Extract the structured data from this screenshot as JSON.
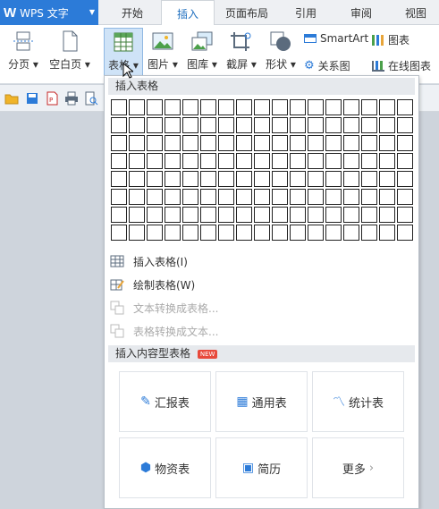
{
  "app": {
    "name": "WPS 文字"
  },
  "tabs": [
    {
      "label": "开始"
    },
    {
      "label": "插入"
    },
    {
      "label": "页面布局"
    },
    {
      "label": "引用"
    },
    {
      "label": "审阅"
    },
    {
      "label": "视图"
    }
  ],
  "ribbon": {
    "page_break": "分页",
    "blank_page": "空白页",
    "table": "表格",
    "picture": "图片",
    "gallery": "图库",
    "screenshot": "截屏",
    "shape": "形状",
    "smartart": "SmartArt",
    "chart": "图表",
    "relation": "关系图",
    "online_chart": "在线图表"
  },
  "dropdown": {
    "insert_table_header": "插入表格",
    "grid": {
      "columns": 17,
      "rows": 8
    },
    "menu": {
      "insert_table": "插入表格(I)",
      "draw_table": "绘制表格(W)",
      "text_to_table": "文本转换成表格...",
      "table_to_text": "表格转换成文本..."
    },
    "content_header": "插入内容型表格",
    "new_badge": "NEW",
    "cards": {
      "report": "汇报表",
      "general": "通用表",
      "stats": "统计表",
      "materials": "物资表",
      "resume": "简历",
      "more": "更多"
    }
  },
  "colors": {
    "accent": "#2c7bd8",
    "active_tab_text": "#1f6fbf",
    "new_badge": "#e84a3c"
  }
}
